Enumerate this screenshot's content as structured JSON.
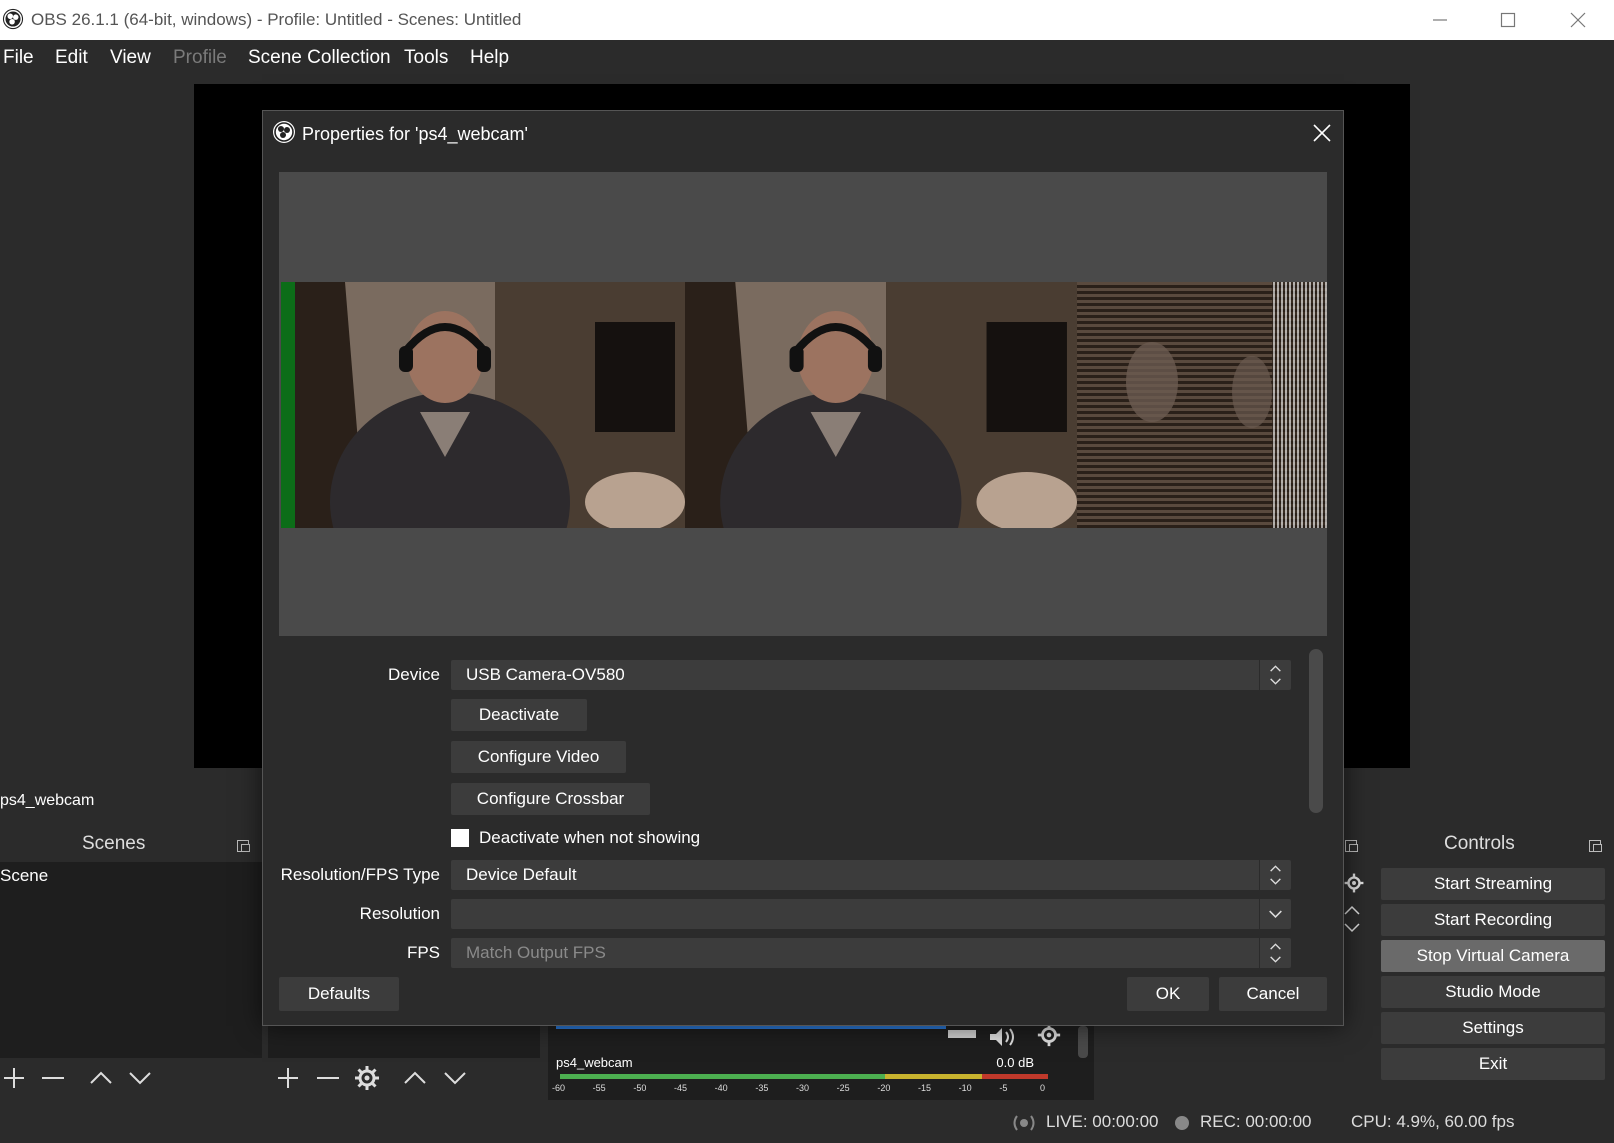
{
  "window": {
    "title": "OBS 26.1.1 (64-bit, windows) - Profile: Untitled - Scenes: Untitled"
  },
  "menu": {
    "items": [
      "File",
      "Edit",
      "View",
      "Profile",
      "Scene Collection",
      "Tools",
      "Help"
    ],
    "disabled": [
      "Profile"
    ]
  },
  "source_strip": {
    "selected_source": "ps4_webcam"
  },
  "scenes_dock": {
    "title": "Scenes",
    "items": [
      "Scene"
    ]
  },
  "mixer": {
    "source_name": "ps4_webcam",
    "level": "0.0 dB",
    "ticks": [
      "-60",
      "-55",
      "-50",
      "-45",
      "-40",
      "-35",
      "-30",
      "-25",
      "-20",
      "-15",
      "-10",
      "-5",
      "0"
    ]
  },
  "controls_dock": {
    "title": "Controls",
    "buttons": {
      "start_streaming": "Start Streaming",
      "start_recording": "Start Recording",
      "stop_virtual_camera": "Stop Virtual Camera",
      "studio_mode": "Studio Mode",
      "settings": "Settings",
      "exit": "Exit"
    }
  },
  "status": {
    "live": "LIVE: 00:00:00",
    "rec": "REC: 00:00:00",
    "cpu": "CPU: 4.9%, 60.00 fps"
  },
  "dialog": {
    "title": "Properties for 'ps4_webcam'",
    "device_label": "Device",
    "device_value": "USB Camera-OV580",
    "deactivate": "Deactivate",
    "configure_video": "Configure Video",
    "configure_crossbar": "Configure Crossbar",
    "deactivate_when_not_showing": "Deactivate when not showing",
    "deactivate_when_not_showing_checked": false,
    "resolution_fps_type_label": "Resolution/FPS Type",
    "resolution_fps_type_value": "Device Default",
    "resolution_label": "Resolution",
    "resolution_value": "",
    "fps_label": "FPS",
    "fps_value": "Match Output FPS",
    "defaults": "Defaults",
    "ok": "OK",
    "cancel": "Cancel"
  },
  "icons": {
    "app_logo": "obs-logo-icon",
    "minimize": "minimize-icon",
    "maximize": "maximize-icon",
    "close": "close-icon",
    "add": "plus-icon",
    "remove": "minus-icon",
    "move_up": "chevron-up-icon",
    "move_down": "chevron-down-icon",
    "gear": "gear-icon",
    "volume": "speaker-icon",
    "live_indicator": "broadcast-icon",
    "rec_indicator": "record-dot-icon"
  },
  "colors": {
    "background": "#2b2b2b",
    "panel": "#3c3c3c",
    "list_bg": "#1e1e1e",
    "active_button": "#6a6a6a",
    "meter_green": "#4caf50",
    "meter_yellow": "#c8b32e",
    "meter_red": "#c0392b",
    "mixer_bar_blue": "#2a7ad9"
  }
}
